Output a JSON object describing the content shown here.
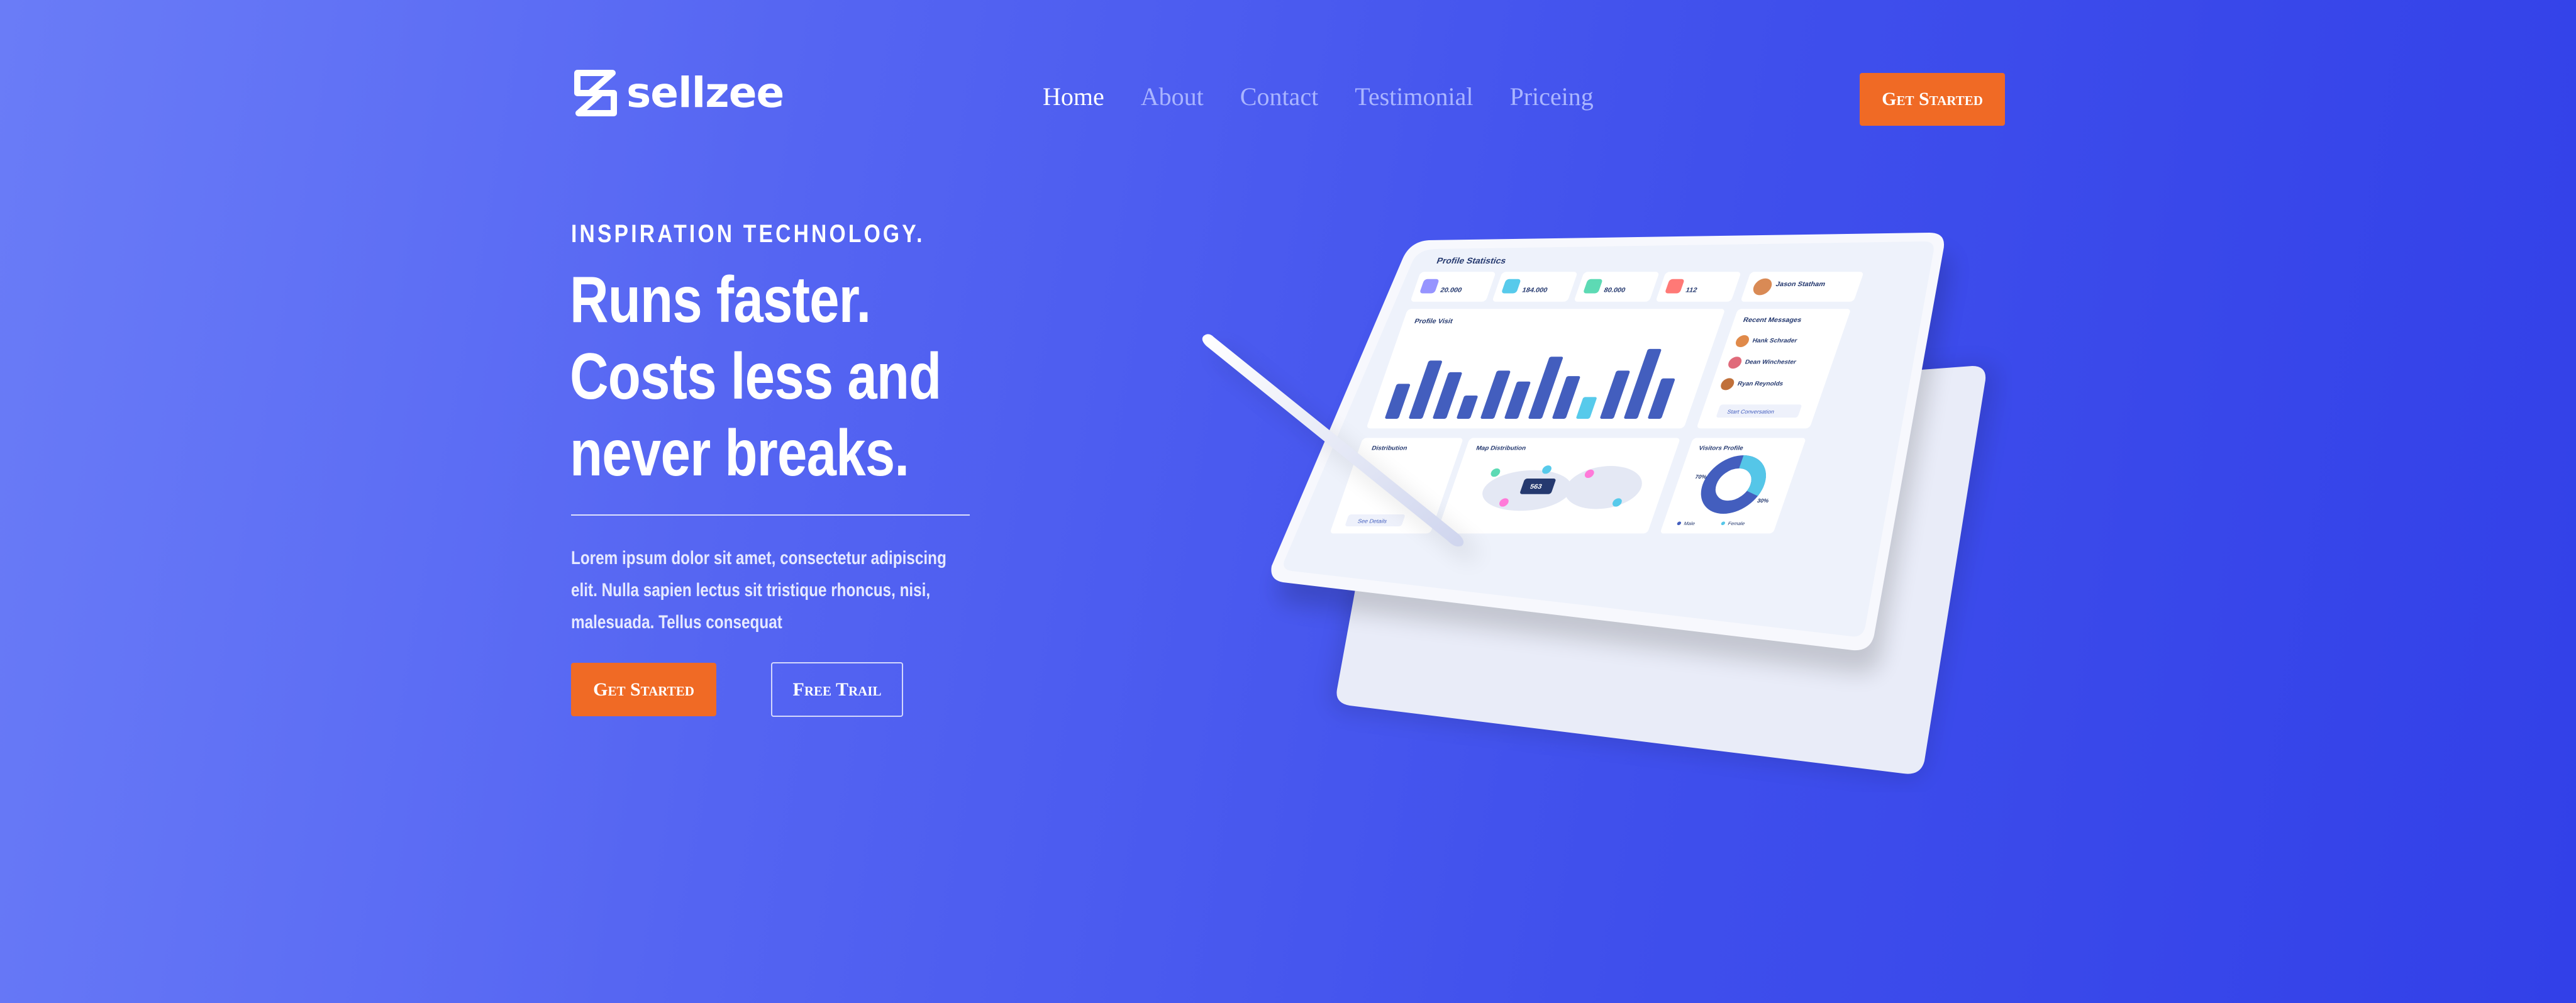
{
  "brand": {
    "name": "sellzee",
    "logo_icon": "s-logo-icon"
  },
  "nav": {
    "items": [
      {
        "label": "Home",
        "active": true
      },
      {
        "label": "About",
        "active": false
      },
      {
        "label": "Contact",
        "active": false
      },
      {
        "label": "Testimonial",
        "active": false
      },
      {
        "label": "Priceing",
        "active": false
      }
    ],
    "cta_label": "Get Started"
  },
  "hero": {
    "eyebrow": "INSPIRATION TECHNOLOGY.",
    "headline": [
      "Runs faster.",
      "Costs less and",
      "never breaks."
    ],
    "body": "Lorem ipsum dolor sit amet, consectetur adipiscing elit. Nulla sapien lectus sit tristique rhoncus, nisi, malesuada. Tellus consequat",
    "primary_cta": "Get Started",
    "secondary_cta": "Free Trail"
  },
  "colors": {
    "accent": "#f06a25",
    "background_start": "#6a7cf7",
    "background_end": "#3240e8",
    "nav_inactive": "#aab5ff"
  },
  "dashboard": {
    "title": "Profile Statistics",
    "stats_values": [
      "20.000",
      "184.000",
      "80.000",
      "112"
    ],
    "profile_name": "Jason Statham",
    "profile_visit_title": "Profile Visit",
    "profile_visit_bars": [
      0.45,
      0.75,
      0.6,
      0.3,
      0.62,
      0.48,
      0.8,
      0.55,
      0.28,
      0.62,
      0.9,
      0.52
    ],
    "recent_messages_title": "Recent Messages",
    "messages": [
      "Hank Schrader",
      "Dean Winchester",
      "Ryan Reynolds"
    ],
    "start_conversation": "Start Conversation",
    "distribution_title": "Distribution",
    "map_distribution_title": "Map Distribution",
    "map_value": "563",
    "visitors_profile_title": "Visitors Profile",
    "donut_labels": [
      "70%",
      "30%"
    ],
    "legend": [
      "Male",
      "Female"
    ],
    "see_details": "See Details"
  }
}
